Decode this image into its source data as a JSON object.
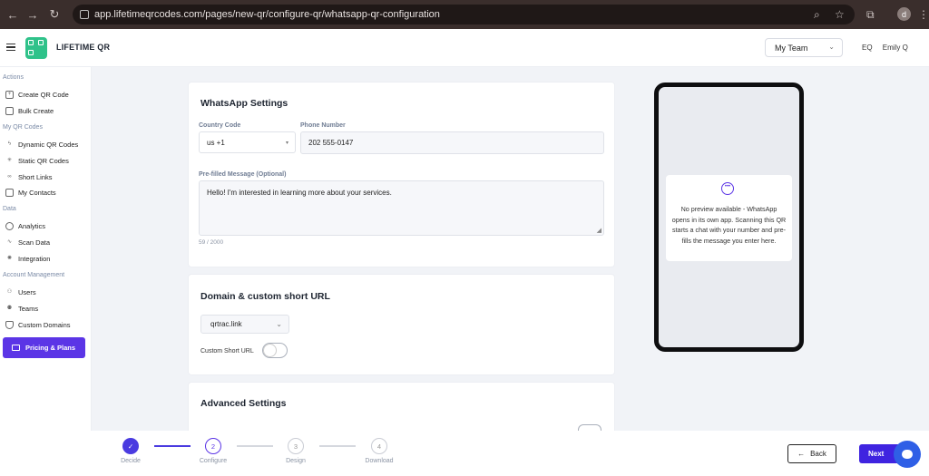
{
  "browser": {
    "url": "app.lifetimeqrcodes.com/pages/new-qr/configure-qr/whatsapp-qr-configuration",
    "profile_initial": "d"
  },
  "header": {
    "brand": "LIFETIME QR",
    "team_select": "My Team",
    "user_initials": "EQ",
    "user_name": "Emily Q"
  },
  "sidebar": {
    "sections": [
      "Actions",
      "My QR Codes",
      "Data",
      "Account Management"
    ],
    "items": [
      "Create QR Code",
      "Bulk Create",
      "Dynamic QR Codes",
      "Static QR Codes",
      "Short Links",
      "My Contacts",
      "Analytics",
      "Scan Data",
      "Integration",
      "Users",
      "Teams",
      "Custom Domains"
    ],
    "pricing": "Pricing & Plans"
  },
  "whatsapp": {
    "title": "WhatsApp Settings",
    "country_code_label": "Country Code",
    "country_code_value": "us +1",
    "phone_label": "Phone Number",
    "phone_value": "202 555-0147",
    "message_label": "Pre-filled Message (Optional)",
    "message_value": "Hello! I'm interested in learning more about your services.",
    "counter": "59 / 2000"
  },
  "domain": {
    "title": "Domain & custom short URL",
    "domain_select": "qrtrac.link",
    "custom_label": "Custom Short URL"
  },
  "advanced": {
    "title": "Advanced Settings"
  },
  "preview": {
    "text": "No preview available - WhatsApp opens in its own app. Scanning this QR starts a chat with your number and pre-fills the message you enter here."
  },
  "footer": {
    "steps": [
      {
        "num": "",
        "label": "Decide"
      },
      {
        "num": "2",
        "label": "Configure"
      },
      {
        "num": "3",
        "label": "Design"
      },
      {
        "num": "4",
        "label": "Download"
      }
    ],
    "back": "Back",
    "next": "Next"
  }
}
